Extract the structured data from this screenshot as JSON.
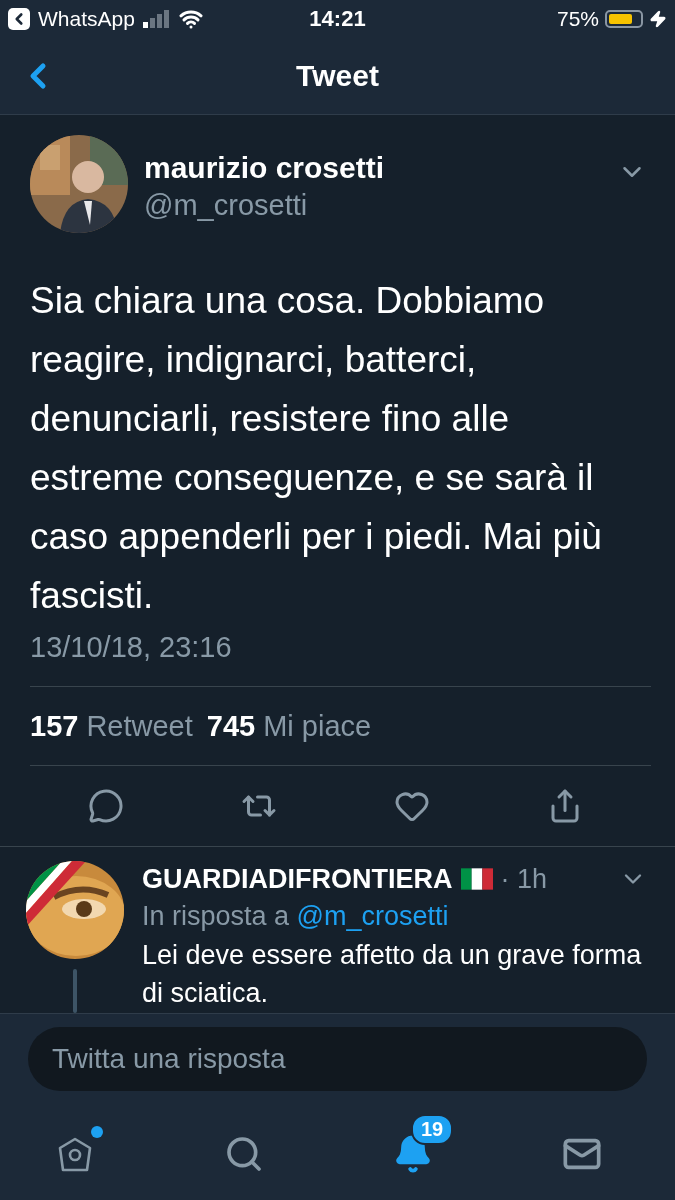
{
  "status_bar": {
    "back_app": "WhatsApp",
    "time": "14:21",
    "battery": "75%",
    "charging": true
  },
  "nav": {
    "title": "Tweet"
  },
  "tweet": {
    "author": "maurizio crosetti",
    "handle": "@m_crosetti",
    "text": "Sia chiara una cosa. Dobbiamo reagire, indignarci, batterci, denunciarli, resistere fino alle estreme conseguenze, e se sarà il caso appenderli per i piedi. Mai più fascisti.",
    "date": "13/10/18, 23:16",
    "stats": [
      {
        "count": "157",
        "label": "Retweet"
      },
      {
        "count": "745",
        "label": "Mi piace"
      }
    ],
    "actions": [
      {
        "kind": "reply"
      },
      {
        "kind": "retweet"
      },
      {
        "kind": "like"
      },
      {
        "kind": "share"
      }
    ]
  },
  "reply": {
    "author": "GUARDIADIFRONTIERA",
    "flag": true,
    "time": "· 1h",
    "in_reply_prefix": "In risposta a",
    "in_reply_handle": "@m_crosetti",
    "text": "Lei deve essere affetto da un grave forma di sciatica."
  },
  "composer": {
    "placeholder": "Twitta una risposta"
  },
  "tabs": [
    {
      "kind": "home",
      "selected": false,
      "dot": true
    },
    {
      "kind": "search",
      "selected": false
    },
    {
      "kind": "notifications",
      "selected": true,
      "badge": "19"
    },
    {
      "kind": "messages",
      "selected": false
    }
  ]
}
